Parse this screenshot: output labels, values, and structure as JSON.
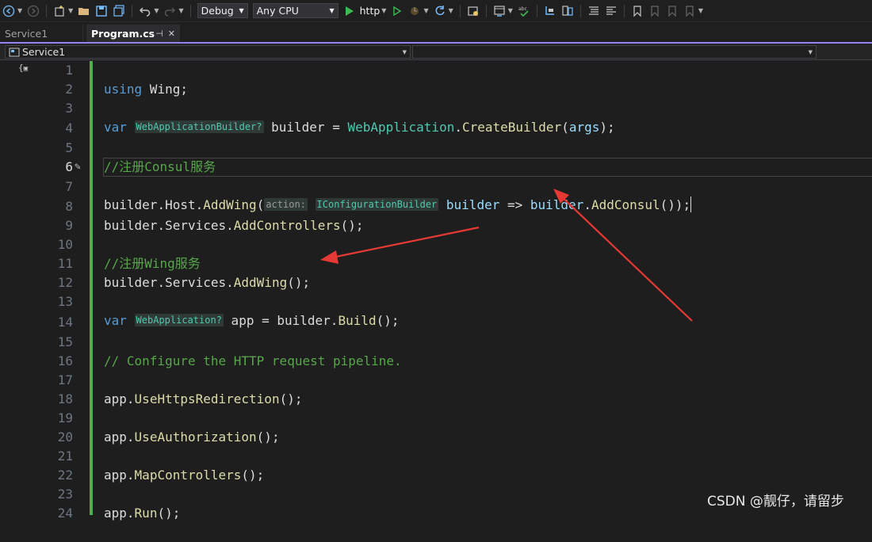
{
  "toolbar": {
    "config": "Debug",
    "platform": "Any CPU",
    "run_target": "http"
  },
  "tabs": [
    {
      "label": "Service1",
      "active": false
    },
    {
      "label": "Program.cs",
      "active": true
    }
  ],
  "navbar": {
    "project": "Service1",
    "member": ""
  },
  "editor": {
    "current_line": 6,
    "lines": [
      {
        "n": "1"
      },
      {
        "n": "2"
      },
      {
        "n": "3"
      },
      {
        "n": "4"
      },
      {
        "n": "5"
      },
      {
        "n": "6"
      },
      {
        "n": "7"
      },
      {
        "n": "8"
      },
      {
        "n": "9"
      },
      {
        "n": "10"
      },
      {
        "n": "11"
      },
      {
        "n": "12"
      },
      {
        "n": "13"
      },
      {
        "n": "14"
      },
      {
        "n": "15"
      },
      {
        "n": "16"
      },
      {
        "n": "17"
      },
      {
        "n": "18"
      },
      {
        "n": "19"
      },
      {
        "n": "20"
      },
      {
        "n": "21"
      },
      {
        "n": "22"
      },
      {
        "n": "23"
      },
      {
        "n": "24"
      }
    ],
    "code": {
      "l1": {
        "kw": "using",
        "ns": " Wing;"
      },
      "l3": {
        "kw": "var",
        "hint": "WebApplicationBuilder?",
        "var": " builder",
        "eq": " = ",
        "type": "WebApplication",
        "dot": ".",
        "method": "CreateBuilder",
        "open": "(",
        "param": "args",
        "close": ");"
      },
      "l5": {
        "comment": "//注册Consul服务"
      },
      "l6": {
        "obj": "builder",
        "p1": ".",
        "host": "Host",
        "p2": ".",
        "method": "AddWing",
        "open": "(",
        "hint_name": "action:",
        "hint_type": "IConfigurationBuilder",
        "lambda_param": "builder",
        "arrow": " => ",
        "obj2": "builder",
        "p3": ".",
        "method2": "AddConsul",
        "close": "());"
      },
      "l8": {
        "obj": "builder",
        "p1": ".",
        "prop": "Services",
        "p2": ".",
        "method": "AddControllers",
        "close": "();"
      },
      "l10": {
        "comment": "//注册Wing服务"
      },
      "l11": {
        "obj": "builder",
        "p1": ".",
        "prop": "Services",
        "p2": ".",
        "method": "AddWing",
        "close": "();"
      },
      "l13": {
        "kw": "var",
        "hint": "WebApplication?",
        "var": " app",
        "eq": " = ",
        "obj": "builder",
        "p1": ".",
        "method": "Build",
        "close": "();"
      },
      "l15": {
        "comment": "// Configure the HTTP request pipeline."
      },
      "l17": {
        "obj": "app",
        "p1": ".",
        "method": "UseHttpsRedirection",
        "close": "();"
      },
      "l19": {
        "obj": "app",
        "p1": ".",
        "method": "UseAuthorization",
        "close": "();"
      },
      "l21": {
        "obj": "app",
        "p1": ".",
        "method": "MapControllers",
        "close": "();"
      },
      "l23": {
        "obj": "app",
        "p1": ".",
        "method": "Run",
        "close": "();"
      }
    }
  },
  "watermark": "CSDN @靓仔，请留步",
  "colors": {
    "keyword": "#569cd6",
    "type": "#4ec9b0",
    "method": "#dcdcaa",
    "comment": "#57a64a",
    "change_bar": "#4caf50",
    "annotation_arrow": "#e53935",
    "tab_accent": "#9184ee"
  },
  "icons": [
    "back-icon",
    "forward-icon",
    "new-project-icon",
    "open-folder-icon",
    "save-icon",
    "save-all-icon",
    "undo-icon",
    "redo-icon",
    "start-icon",
    "start-without-debugging-icon",
    "hot-reload-icon",
    "refresh-icon",
    "bookmark-icon",
    "pin-icon",
    "close-icon",
    "outline-icon",
    "pencil-icon"
  ]
}
